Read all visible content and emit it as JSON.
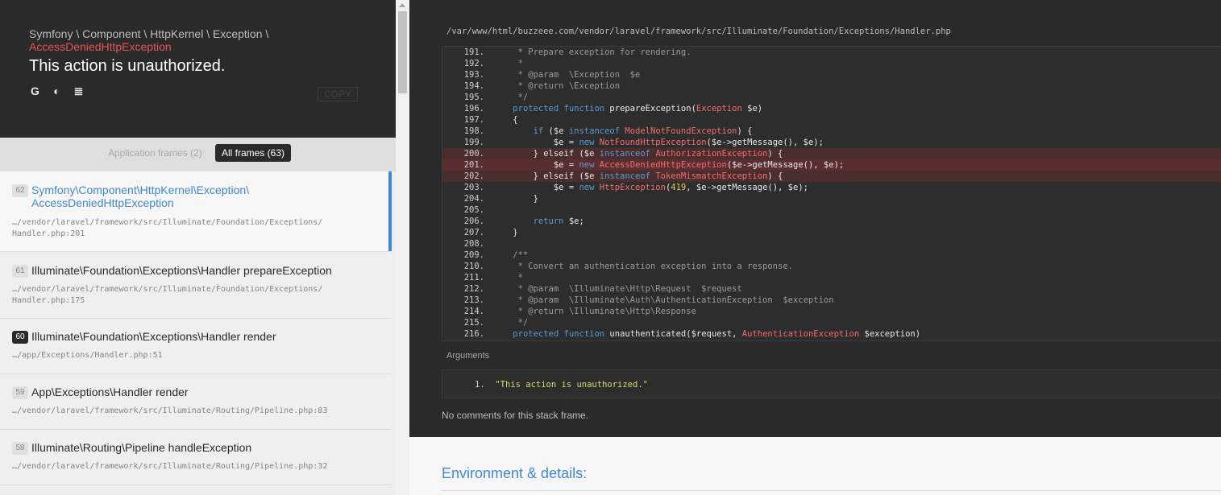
{
  "header": {
    "exception_namespace": "Symfony \\ Component \\ HttpKernel \\ Exception \\",
    "exception_name": "AccessDeniedHttpException",
    "message": "This action is unauthorized.",
    "copy_label": "COPY",
    "icons": [
      "google-icon",
      "duckduckgo-icon",
      "stackoverflow-icon"
    ]
  },
  "filters": {
    "app_frames": "Application frames (2)",
    "all_frames": "All frames (63)"
  },
  "frames": [
    {
      "num": "62",
      "cls1": "Symfony\\Component\\HttpKernel\\Exception\\",
      "cls2": "AccessDeniedHttpException",
      "file1": "…/vendor/laravel/framework/src/Illuminate/Foundation/Exceptions/",
      "file2": "Handler.php:201"
    },
    {
      "num": "61",
      "cls1": "Illuminate\\Foundation\\Exceptions\\Handler prepareException",
      "file1": "…/vendor/laravel/framework/src/Illuminate/Foundation/Exceptions/",
      "file2": "Handler.php:175"
    },
    {
      "num": "60",
      "cls1": "Illuminate\\Foundation\\Exceptions\\Handler render",
      "file1": "…/app/Exceptions/Handler.php:51"
    },
    {
      "num": "59",
      "cls1": "App\\Exceptions\\Handler render",
      "file1": "…/vendor/laravel/framework/src/Illuminate/Routing/Pipeline.php:83"
    },
    {
      "num": "58",
      "cls1": "Illuminate\\Routing\\Pipeline handleException",
      "file1": "…/vendor/laravel/framework/src/Illuminate/Routing/Pipeline.php:32"
    }
  ],
  "code": {
    "file_path": "/var/www/html/buzzeee.com/vendor/laravel/framework/src/Illuminate/Foundation/Exceptions/Handler.php",
    "lines": [
      {
        "n": "191.",
        "t": "     * Prepare exception for rendering."
      },
      {
        "n": "192.",
        "t": "     *"
      },
      {
        "n": "193.",
        "t": "     * @param  \\Exception  $e"
      },
      {
        "n": "194.",
        "t": "     * @return \\Exception"
      },
      {
        "n": "195.",
        "t": "     */"
      },
      {
        "n": "196.",
        "t": "    protected function prepareException(Exception $e)"
      },
      {
        "n": "197.",
        "t": "    {"
      },
      {
        "n": "198.",
        "t": "        if ($e instanceof ModelNotFoundException) {"
      },
      {
        "n": "199.",
        "t": "            $e = new NotFoundHttpException($e->getMessage(), $e);"
      },
      {
        "n": "200.",
        "t": "        } elseif ($e instanceof AuthorizationException) {"
      },
      {
        "n": "201.",
        "t": "            $e = new AccessDeniedHttpException($e->getMessage(), $e);"
      },
      {
        "n": "202.",
        "t": "        } elseif ($e instanceof TokenMismatchException) {"
      },
      {
        "n": "203.",
        "t": "            $e = new HttpException(419, $e->getMessage(), $e);"
      },
      {
        "n": "204.",
        "t": "        }"
      },
      {
        "n": "205.",
        "t": ""
      },
      {
        "n": "206.",
        "t": "        return $e;"
      },
      {
        "n": "207.",
        "t": "    }"
      },
      {
        "n": "208.",
        "t": ""
      },
      {
        "n": "209.",
        "t": "    /**"
      },
      {
        "n": "210.",
        "t": "     * Convert an authentication exception into a response."
      },
      {
        "n": "211.",
        "t": "     *"
      },
      {
        "n": "212.",
        "t": "     * @param  \\Illuminate\\Http\\Request  $request"
      },
      {
        "n": "213.",
        "t": "     * @param  \\Illuminate\\Auth\\AuthenticationException  $exception"
      },
      {
        "n": "214.",
        "t": "     * @return \\Illuminate\\Http\\Response"
      },
      {
        "n": "215.",
        "t": "     */"
      },
      {
        "n": "216.",
        "t": "    protected function unauthenticated($request, AuthenticationException $exception)"
      }
    ]
  },
  "arguments": {
    "title": "Arguments",
    "items": [
      {
        "index": "1.",
        "value": "\"This action is unauthorized.\""
      }
    ]
  },
  "no_comments": "No comments for this stack frame.",
  "environment_title": "Environment & details:",
  "colors": {
    "accent": "#4288ce",
    "error": "#e95353",
    "dark": "#2a2a2a"
  }
}
